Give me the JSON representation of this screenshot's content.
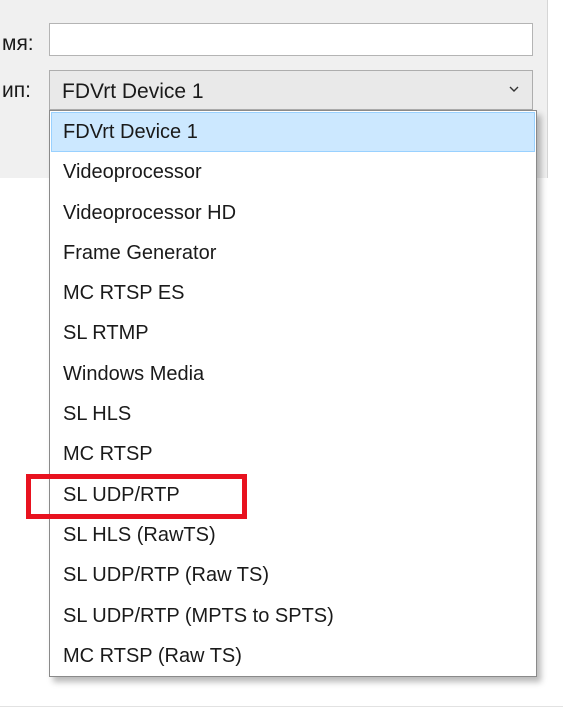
{
  "form": {
    "name_label": "мя:",
    "name_value": "",
    "type_label": "ип:",
    "type_selected": "FDVrt Device 1"
  },
  "dropdown": {
    "options": [
      "FDVrt Device 1",
      "Videoprocessor",
      "Videoprocessor HD",
      "Frame Generator",
      "MC RTSP ES",
      "SL RTMP",
      "Windows Media",
      "SL HLS",
      "MC RTSP",
      "SL UDP/RTP",
      "SL HLS (RawTS)",
      "SL UDP/RTP (Raw TS)",
      "SL UDP/RTP (MPTS to SPTS)",
      "MC RTSP (Raw TS)"
    ],
    "selected_index": 0,
    "highlighted_option": "SL UDP/RTP"
  },
  "icons": {
    "select_arrow": "chevron-down-icon"
  },
  "colors": {
    "selected_background": "#cce8ff",
    "selected_border": "#99d1ff",
    "highlight_annotation": "#e8121f",
    "panel_background": "#f0f0f0"
  }
}
